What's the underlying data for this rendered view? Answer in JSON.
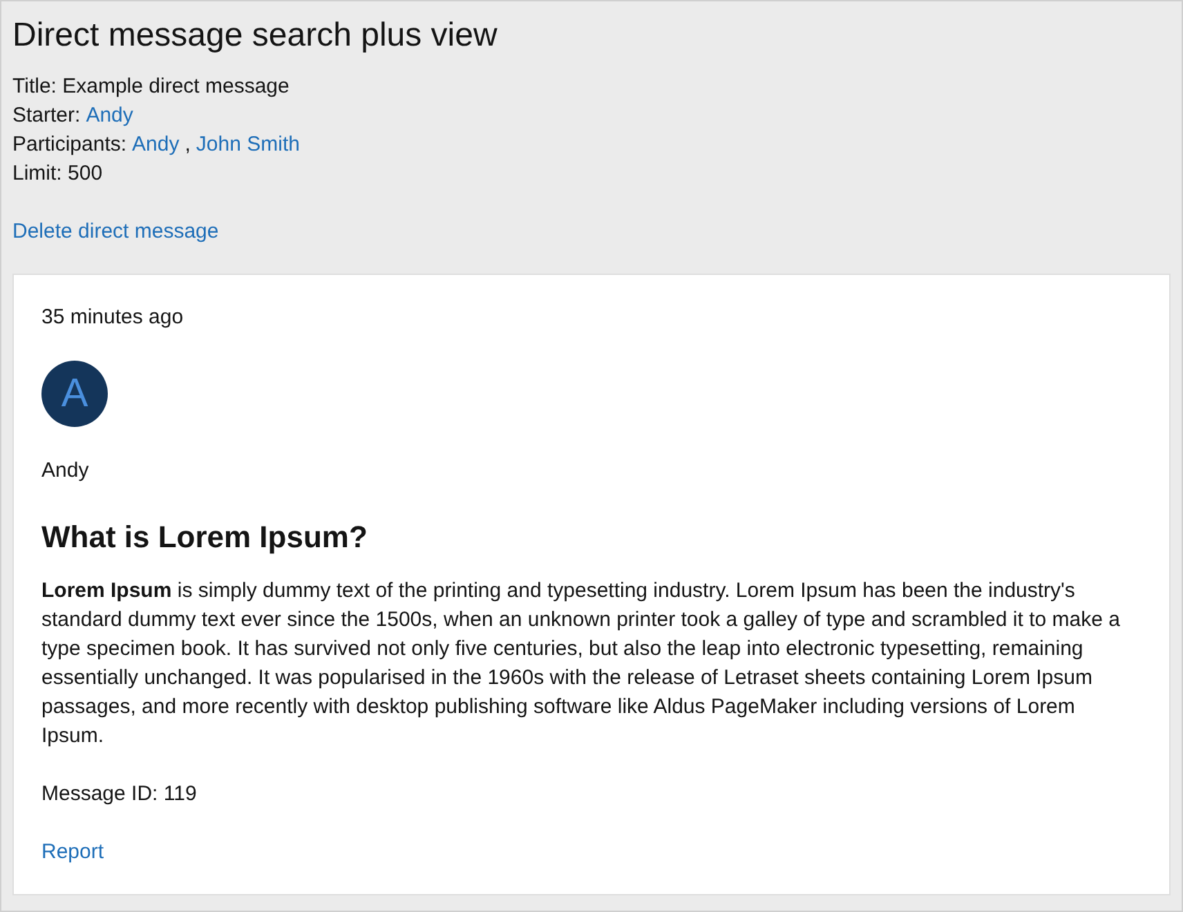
{
  "page": {
    "title": "Direct message search plus view"
  },
  "details": [
    {
      "kind": "text",
      "label": "Title:",
      "value": "Example direct message"
    },
    {
      "kind": "links",
      "label": "Starter:",
      "links": [
        "Andy"
      ]
    },
    {
      "kind": "links",
      "label": "Participants:",
      "links": [
        "Andy",
        "John Smith"
      ],
      "separator": ","
    },
    {
      "kind": "text",
      "label": "Limit:",
      "value": "500"
    }
  ],
  "actions": [
    {
      "label": "Delete direct message"
    }
  ],
  "message": {
    "time": "35 minutes ago",
    "avatar_letter": "A",
    "author": "Andy",
    "heading": "What is Lorem Ipsum?",
    "body": "**Lorem Ipsum** is simply dummy text of the printing and typesetting industry. Lorem Ipsum has been the industry's standard dummy text ever since the 1500s, when an unknown printer took a galley of type and scrambled it to make a type specimen book. It has survived not only five centuries, but also the leap into electronic typesetting, remaining essentially unchanged. It was popularised in the 1960s with the release of Letraset sheets containing Lorem Ipsum passages, and more recently with desktop publishing software like Aldus PageMaker including versions of Lorem Ipsum.",
    "message_id": "Message ID: 119",
    "report": "Report"
  }
}
